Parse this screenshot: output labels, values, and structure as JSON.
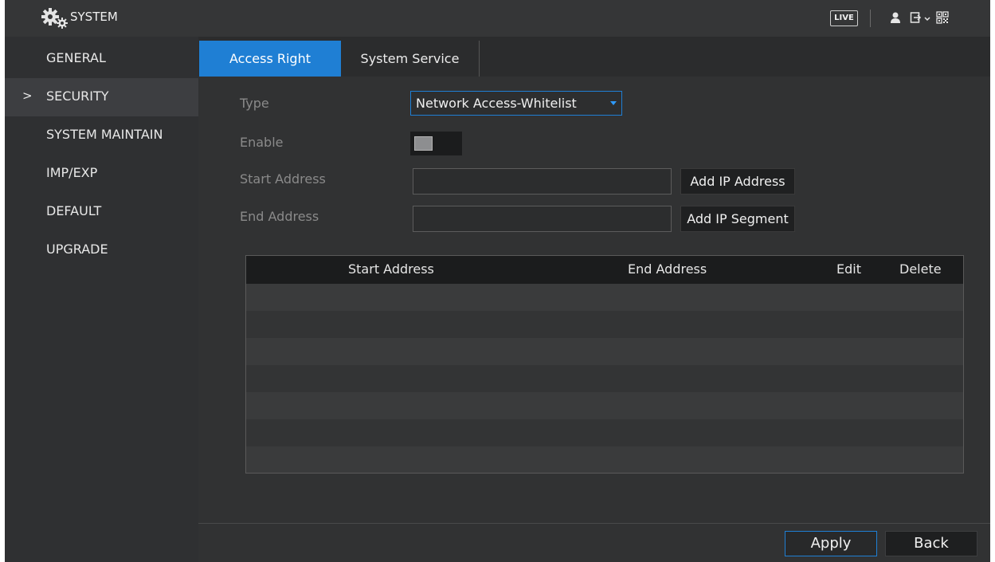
{
  "header": {
    "title": "SYSTEM",
    "live_label": "LIVE",
    "icons": [
      "gear-icon",
      "user-icon",
      "logout-icon",
      "chevron-down-icon",
      "qr-code-icon"
    ]
  },
  "sidebar": {
    "items": [
      {
        "label": "GENERAL",
        "active": false
      },
      {
        "label": "SECURITY",
        "active": true
      },
      {
        "label": "SYSTEM MAINTAIN",
        "active": false
      },
      {
        "label": "IMP/EXP",
        "active": false
      },
      {
        "label": "DEFAULT",
        "active": false
      },
      {
        "label": "UPGRADE",
        "active": false
      }
    ],
    "active_marker": ">"
  },
  "tabs": [
    {
      "label": "Access Right",
      "active": true
    },
    {
      "label": "System Service",
      "active": false
    }
  ],
  "form": {
    "type_label": "Type",
    "type_value": "Network Access-Whitelist",
    "enable_label": "Enable",
    "enable_on": false,
    "start_label": "Start Address",
    "start_value": "",
    "end_label": "End Address",
    "end_value": "",
    "add_ip_address": "Add IP Address",
    "add_ip_segment": "Add IP Segment"
  },
  "table": {
    "columns": [
      "Start Address",
      "End Address",
      "Edit",
      "Delete"
    ],
    "rows": []
  },
  "footer": {
    "apply": "Apply",
    "back": "Back"
  },
  "colors": {
    "accent": "#1f7fd4",
    "background": "#2a2b2c",
    "sidebar_active": "#3d3e41"
  }
}
